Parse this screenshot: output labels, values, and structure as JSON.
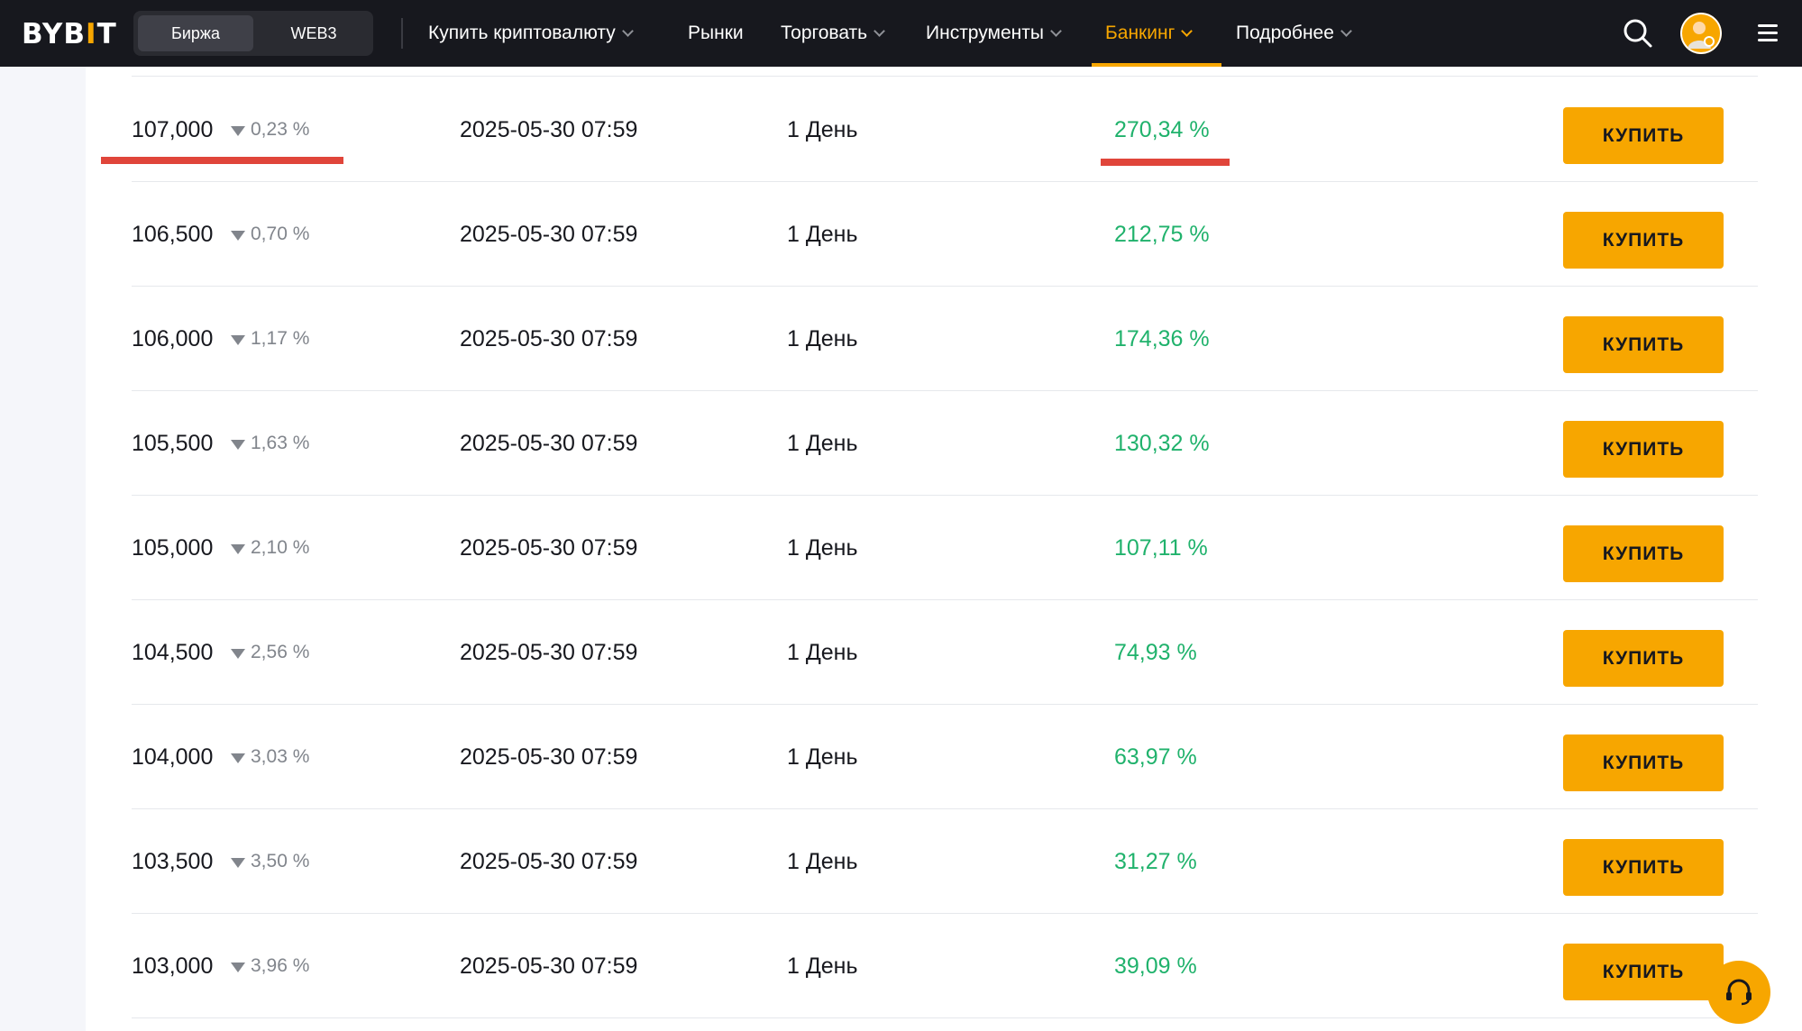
{
  "header": {
    "logo": {
      "text": "BYB",
      "accent": "I",
      "tail": "T"
    },
    "switch": [
      "Биржа",
      "WEB3"
    ],
    "nav": [
      {
        "label": "Купить криптовалюту",
        "has_dropdown": true,
        "active": false
      },
      {
        "label": "Рынки",
        "has_dropdown": false,
        "active": false
      },
      {
        "label": "Торговать",
        "has_dropdown": true,
        "active": false
      },
      {
        "label": "Инструменты",
        "has_dropdown": true,
        "active": false
      },
      {
        "label": "Банкинг",
        "has_dropdown": true,
        "active": true
      },
      {
        "label": "Подробнее",
        "has_dropdown": true,
        "active": false
      }
    ],
    "icons": [
      "search-icon",
      "user-avatar-icon",
      "hamburger-menu-icon"
    ]
  },
  "table": {
    "rows": [
      {
        "strike": "107,000",
        "change": "0,23 %",
        "expiry": "2025-05-30 07:59",
        "duration": "1 День",
        "apr": "270,34 %",
        "action": "КУПИТЬ"
      },
      {
        "strike": "106,500",
        "change": "0,70 %",
        "expiry": "2025-05-30 07:59",
        "duration": "1 День",
        "apr": "212,75 %",
        "action": "КУПИТЬ"
      },
      {
        "strike": "106,000",
        "change": "1,17 %",
        "expiry": "2025-05-30 07:59",
        "duration": "1 День",
        "apr": "174,36 %",
        "action": "КУПИТЬ"
      },
      {
        "strike": "105,500",
        "change": "1,63 %",
        "expiry": "2025-05-30 07:59",
        "duration": "1 День",
        "apr": "130,32 %",
        "action": "КУПИТЬ"
      },
      {
        "strike": "105,000",
        "change": "2,10 %",
        "expiry": "2025-05-30 07:59",
        "duration": "1 День",
        "apr": "107,11 %",
        "action": "КУПИТЬ"
      },
      {
        "strike": "104,500",
        "change": "2,56 %",
        "expiry": "2025-05-30 07:59",
        "duration": "1 День",
        "apr": "74,93 %",
        "action": "КУПИТЬ"
      },
      {
        "strike": "104,000",
        "change": "3,03 %",
        "expiry": "2025-05-30 07:59",
        "duration": "1 День",
        "apr": "63,97 %",
        "action": "КУПИТЬ"
      },
      {
        "strike": "103,500",
        "change": "3,50 %",
        "expiry": "2025-05-30 07:59",
        "duration": "1 День",
        "apr": "31,27 %",
        "action": "КУПИТЬ"
      },
      {
        "strike": "103,000",
        "change": "3,96 %",
        "expiry": "2025-05-30 07:59",
        "duration": "1 День",
        "apr": "39,09 %",
        "action": "КУПИТЬ"
      }
    ]
  },
  "support_icon": "headset-icon",
  "colors": {
    "header_bg": "#17181e",
    "accent": "#f7a600",
    "apr_green": "#20b26c",
    "muted": "#81858c",
    "annotation_red": "#e0453a"
  }
}
